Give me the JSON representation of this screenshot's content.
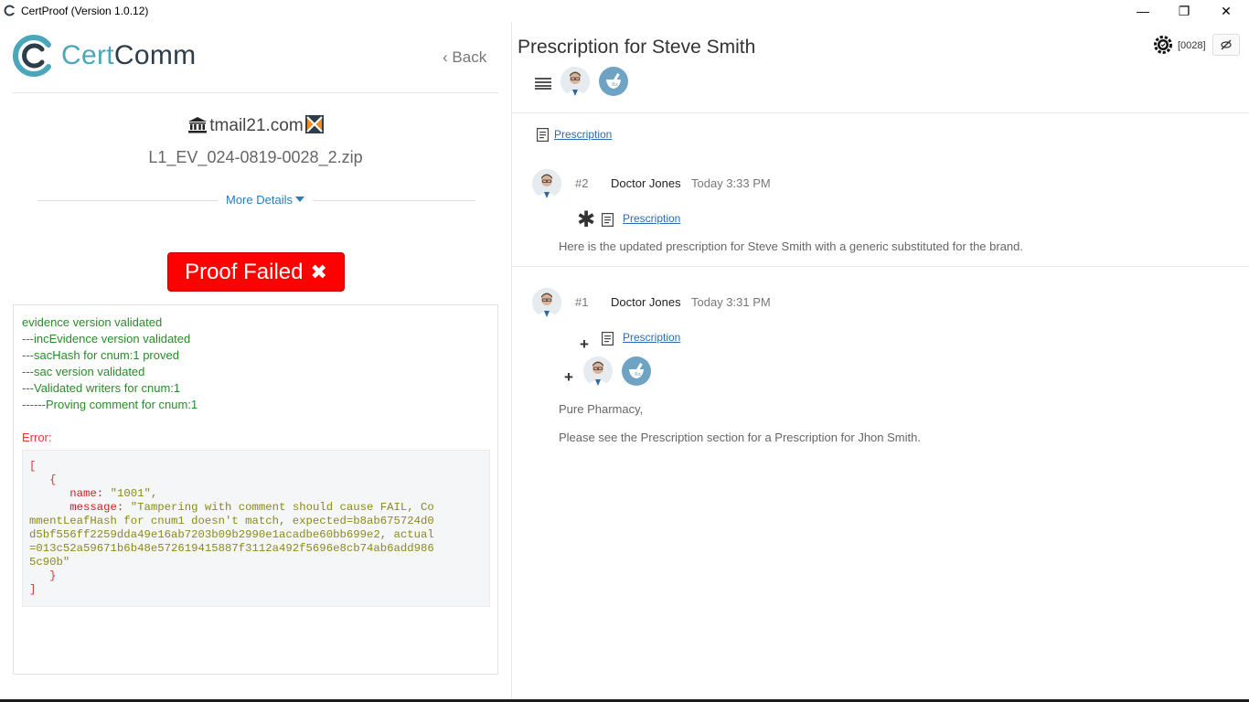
{
  "window": {
    "title": "CertProof (Version 1.0.12)",
    "minimize_glyph": "—",
    "maximize_glyph": "❐",
    "close_glyph": "✕"
  },
  "left": {
    "logo": {
      "part1": "Cert",
      "part2": "Comm"
    },
    "back_label": "Back",
    "domain": "tmail21.com",
    "zip_file": "L1_EV_024-0819-0028_2.zip",
    "more_details": "More Details",
    "proof_status": "Proof Failed",
    "log_lines": [
      "evidence version validated",
      "---incEvidence version validated",
      "---sacHash for cnum:1 proved",
      "---sac version validated",
      "---Validated writers for cnum:1",
      "------Proving comment for cnum:1"
    ],
    "error_label": "Error:",
    "error_detail": {
      "open_bracket": "[",
      "open_brace": "{",
      "name_key": "name:",
      "name_value": "\"1001\",",
      "message_key": "message:",
      "message_line1": "\"Tampering with comment should cause FAIL, Co",
      "message_line2": "mmentLeafHash for cnum1 doesn't match, expected=b8ab675724d0",
      "message_line3": "d5bf556ff2259dda49e16ab7203b09b2990e1acadbe60bb699e2, actual",
      "message_line4": "=013c52a59671b6b48e572619415887f3112a492f5696e8cb74ab6add986",
      "message_line5": "5c90b\"",
      "close_brace": "}",
      "close_bracket": "]"
    }
  },
  "right": {
    "title": "Prescription for Steve Smith",
    "seq_label": "[0028]",
    "top_attachment": "Prescription",
    "messages": [
      {
        "num": "#2",
        "author": "Doctor Jones",
        "time": "Today 3:33 PM",
        "attachment": "Prescription",
        "body": "Here is the updated prescription for Steve Smith with a generic substituted for the brand."
      },
      {
        "num": "#1",
        "author": "Doctor Jones",
        "time": "Today 3:31 PM",
        "attachment": "Prescription",
        "body_line1": "Pure Pharmacy,",
        "body_line2": "Please see the Prescription section for a Prescription for Jhon Smith."
      }
    ],
    "glyphs": {
      "star": "✱",
      "plus": "+"
    }
  },
  "colors": {
    "accent": "#4aa6b8",
    "brand_dark": "#2d3d4a",
    "fail_red": "#ff0000",
    "success_green": "#2a8a2a",
    "link_blue": "#2b6cb0"
  },
  "icons": [
    "certcomm-logo-icon",
    "bank-icon",
    "x-box-icon",
    "gear-icon",
    "hide-icon",
    "menu-icon",
    "doctor-avatar",
    "pharmacy-icon",
    "document-icon"
  ]
}
